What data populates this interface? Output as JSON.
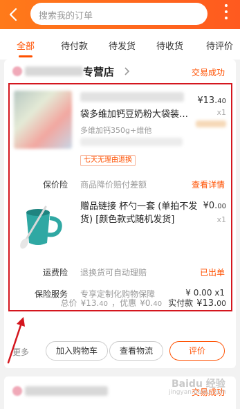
{
  "header": {
    "search_placeholder": "搜索我的订单",
    "colors": {
      "accent": "#ff5000",
      "header_bg": "#ff6a1a"
    }
  },
  "tabs": [
    {
      "label": "全部",
      "active": true
    },
    {
      "label": "待付款",
      "active": false
    },
    {
      "label": "待发货",
      "active": false
    },
    {
      "label": "待收货",
      "active": false
    },
    {
      "label": "待评价",
      "active": false
    }
  ],
  "order": {
    "shop_suffix": "专营店",
    "status": "交易成功",
    "item1": {
      "name": "袋多维加钙豆奶粉大袋装…",
      "spec": "多维加钙350g+维他",
      "price_int": "¥13.",
      "price_dec": "40",
      "qty": "x1",
      "tag": "七天无理由退换"
    },
    "price_protect": {
      "label": "保价险",
      "desc": "商品降价赔付差额",
      "action": "查看详情"
    },
    "item2": {
      "name": "赠品链接 杯勺一套 (单拍不发货) [颜色款式随机发货]",
      "price_int": "¥0.",
      "price_dec": "00",
      "qty": "x1"
    },
    "freight_insurance": {
      "label": "运费险",
      "desc": "退换货可自动理赔",
      "action": "已出单"
    },
    "insurance_service": {
      "label": "保险服务",
      "desc": "专享定制化购物保障",
      "value": "¥ 0.00 x1"
    },
    "totals": {
      "total_label": "总价",
      "total_int": "¥13.",
      "total_dec": "40",
      "discount_label": "，优惠",
      "discount_int": "¥0.",
      "discount_dec": "40",
      "paid_label": "实付款",
      "paid_int": "¥13.",
      "paid_dec": "00"
    },
    "more_label": "更多",
    "buttons": {
      "add_cart": "加入购物车",
      "logistics": "查看物流",
      "review": "评价"
    }
  },
  "next_order": {
    "status": "交易成功"
  },
  "watermark": {
    "text": "Baidu 经验",
    "url": "jingyan.baidu.com"
  }
}
